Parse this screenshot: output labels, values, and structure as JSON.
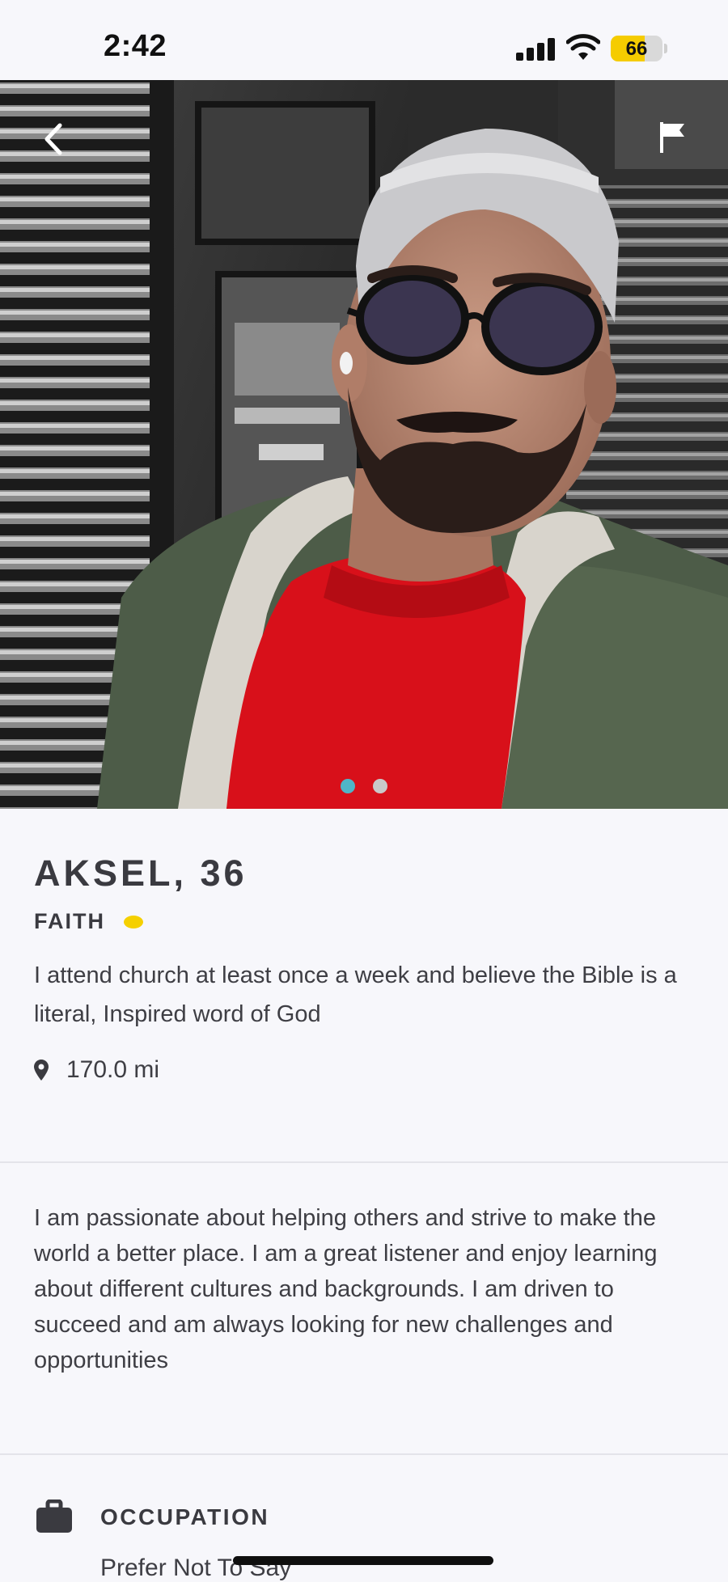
{
  "status_bar": {
    "time": "2:42",
    "battery_level": "66",
    "battery_fraction": 0.66
  },
  "photo": {
    "dots_total": 2,
    "active_dot": 0,
    "dot_active_color": "#4fb5c8",
    "dot_inactive_color": "#c9c9c9",
    "back_icon": "chevron-left-icon",
    "report_icon": "flag-icon"
  },
  "profile": {
    "name_age": "AKSEL, 36",
    "faith_label": "FAITH",
    "faith_icon_color": "#f5d000",
    "faith_description": "I attend church at least once a week and believe the Bible is a literal, Inspired word of God",
    "distance": "170.0 mi",
    "bio": "I am passionate about helping others and strive to make the world a better place. I am a great listener and enjoy learning about different cultures and backgrounds. I am driven to succeed and am always looking for new challenges and opportunities"
  },
  "details": {
    "occupation_label": "OCCUPATION",
    "occupation_value": "Prefer Not To Say"
  }
}
